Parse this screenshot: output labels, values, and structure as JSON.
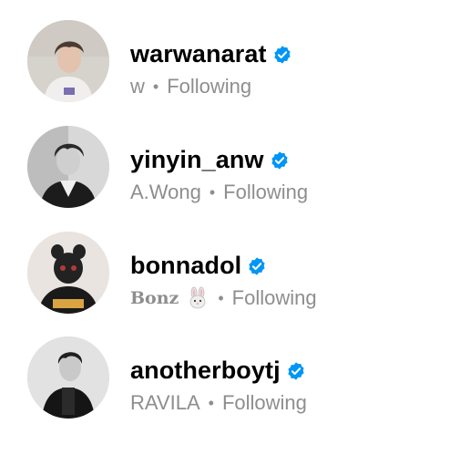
{
  "colors": {
    "username": "#000000",
    "secondary_text": "#8e8e8e",
    "verified_badge": "#0095f6",
    "background": "#ffffff"
  },
  "accounts": [
    {
      "username": "warwanarat",
      "full_name": "w",
      "full_name_emoji": null,
      "separator": "•",
      "status": "Following",
      "verified": true,
      "avatar_icon": "profile-photo"
    },
    {
      "username": "yinyin_anw",
      "full_name": "A.Wong",
      "full_name_emoji": null,
      "separator": "•",
      "status": "Following",
      "verified": true,
      "avatar_icon": "profile-photo"
    },
    {
      "username": "bonnadol",
      "full_name": "Bonz",
      "full_name_emoji": "rabbit-face-icon",
      "separator": "•",
      "status": "Following",
      "verified": true,
      "avatar_icon": "profile-photo"
    },
    {
      "username": "anotherboytj",
      "full_name": "RAVILA",
      "full_name_emoji": null,
      "separator": "•",
      "status": "Following",
      "verified": true,
      "avatar_icon": "profile-photo"
    }
  ]
}
